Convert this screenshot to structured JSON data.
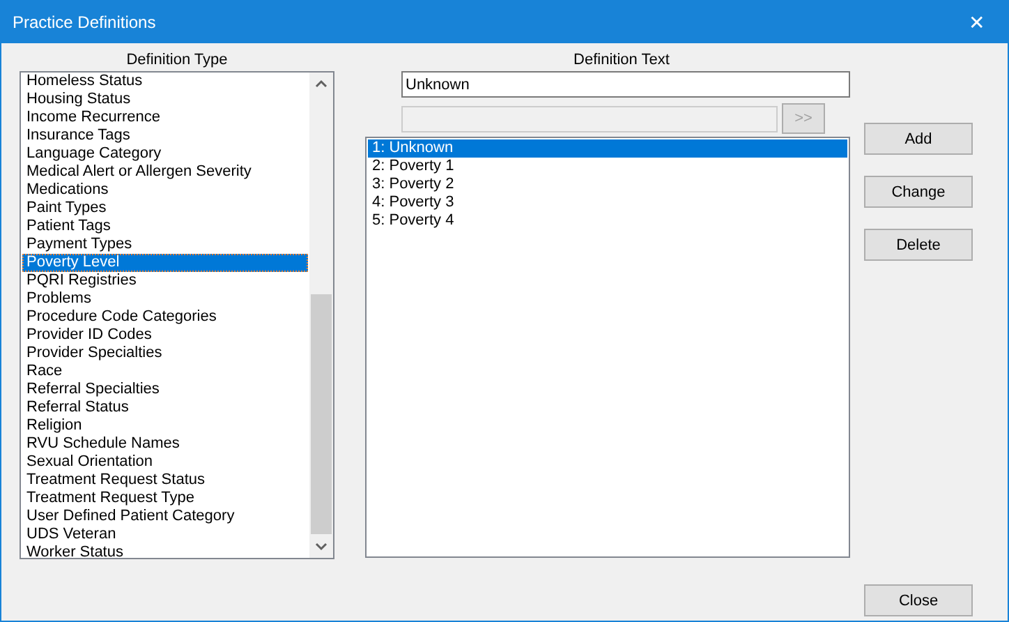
{
  "window": {
    "title": "Practice Definitions",
    "close": "✕"
  },
  "definition_type": {
    "label": "Definition Type",
    "items": [
      {
        "label": "Homeless Status",
        "selected": false
      },
      {
        "label": "Housing Status",
        "selected": false
      },
      {
        "label": "Income Recurrence",
        "selected": false
      },
      {
        "label": "Insurance Tags",
        "selected": false
      },
      {
        "label": "Language Category",
        "selected": false
      },
      {
        "label": "Medical Alert or Allergen Severity",
        "selected": false
      },
      {
        "label": "Medications",
        "selected": false
      },
      {
        "label": "Paint Types",
        "selected": false
      },
      {
        "label": "Patient Tags",
        "selected": false
      },
      {
        "label": "Payment Types",
        "selected": false
      },
      {
        "label": "Poverty Level",
        "selected": true
      },
      {
        "label": "PQRI Registries",
        "selected": false
      },
      {
        "label": "Problems",
        "selected": false
      },
      {
        "label": "Procedure Code Categories",
        "selected": false
      },
      {
        "label": "Provider ID Codes",
        "selected": false
      },
      {
        "label": "Provider Specialties",
        "selected": false
      },
      {
        "label": "Race",
        "selected": false
      },
      {
        "label": "Referral Specialties",
        "selected": false
      },
      {
        "label": "Referral Status",
        "selected": false
      },
      {
        "label": "Religion",
        "selected": false
      },
      {
        "label": "RVU Schedule Names",
        "selected": false
      },
      {
        "label": "Sexual Orientation",
        "selected": false
      },
      {
        "label": "Treatment Request Status",
        "selected": false
      },
      {
        "label": "Treatment Request Type",
        "selected": false
      },
      {
        "label": "User Defined Patient Category",
        "selected": false
      },
      {
        "label": "UDS Veteran",
        "selected": false
      },
      {
        "label": "Worker Status",
        "selected": false
      }
    ]
  },
  "definition_text": {
    "label": "Definition Text",
    "value": "Unknown",
    "secondary_field": {
      "disabled": true
    },
    "move_button": ">>",
    "items": [
      {
        "label": "1: Unknown",
        "selected": true
      },
      {
        "label": "2: Poverty 1",
        "selected": false
      },
      {
        "label": "3: Poverty 2",
        "selected": false
      },
      {
        "label": "4: Poverty 3",
        "selected": false
      },
      {
        "label": "5: Poverty 4",
        "selected": false
      }
    ]
  },
  "buttons": [
    "Add",
    "Change",
    "Delete"
  ],
  "close_button": "Close"
}
